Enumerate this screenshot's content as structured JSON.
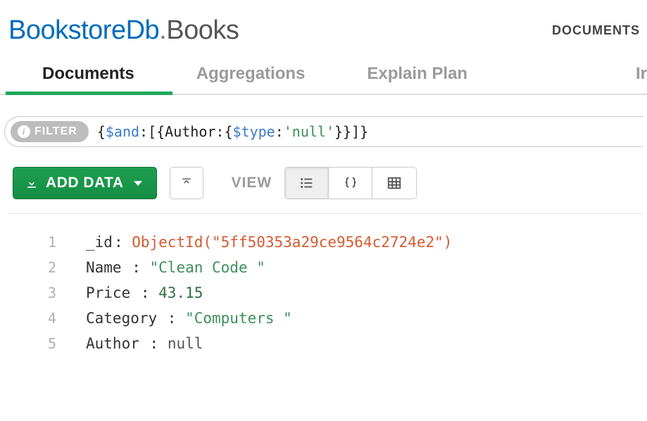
{
  "header": {
    "database": "BookstoreDb",
    "collection": "Books",
    "subnav": "DOCUMENTS"
  },
  "tabs": {
    "documents": "Documents",
    "aggregations": "Aggregations",
    "explain": "Explain Plan",
    "truncated": "Ir"
  },
  "filter": {
    "label": "FILTER",
    "query_open": "{",
    "query_op1": "$and",
    "query_mid1": ":[{Author:{",
    "query_op2": "$type",
    "query_mid2": ":",
    "query_str": "'null'",
    "query_close": "}}]}"
  },
  "toolbar": {
    "add_data": "ADD DATA",
    "view_label": "VIEW"
  },
  "document": {
    "lines": [
      "1",
      "2",
      "3",
      "4",
      "5"
    ],
    "id_key": "_id",
    "id_value": "ObjectId(\"5ff50353a29ce9564c2724e2\")",
    "name_key": "Name ",
    "name_value": "\"Clean Code  \"",
    "price_key": "Price ",
    "price_value": "43.15",
    "category_key": "Category ",
    "category_value": "\"Computers  \"",
    "author_key": "Author ",
    "author_value": "null"
  }
}
